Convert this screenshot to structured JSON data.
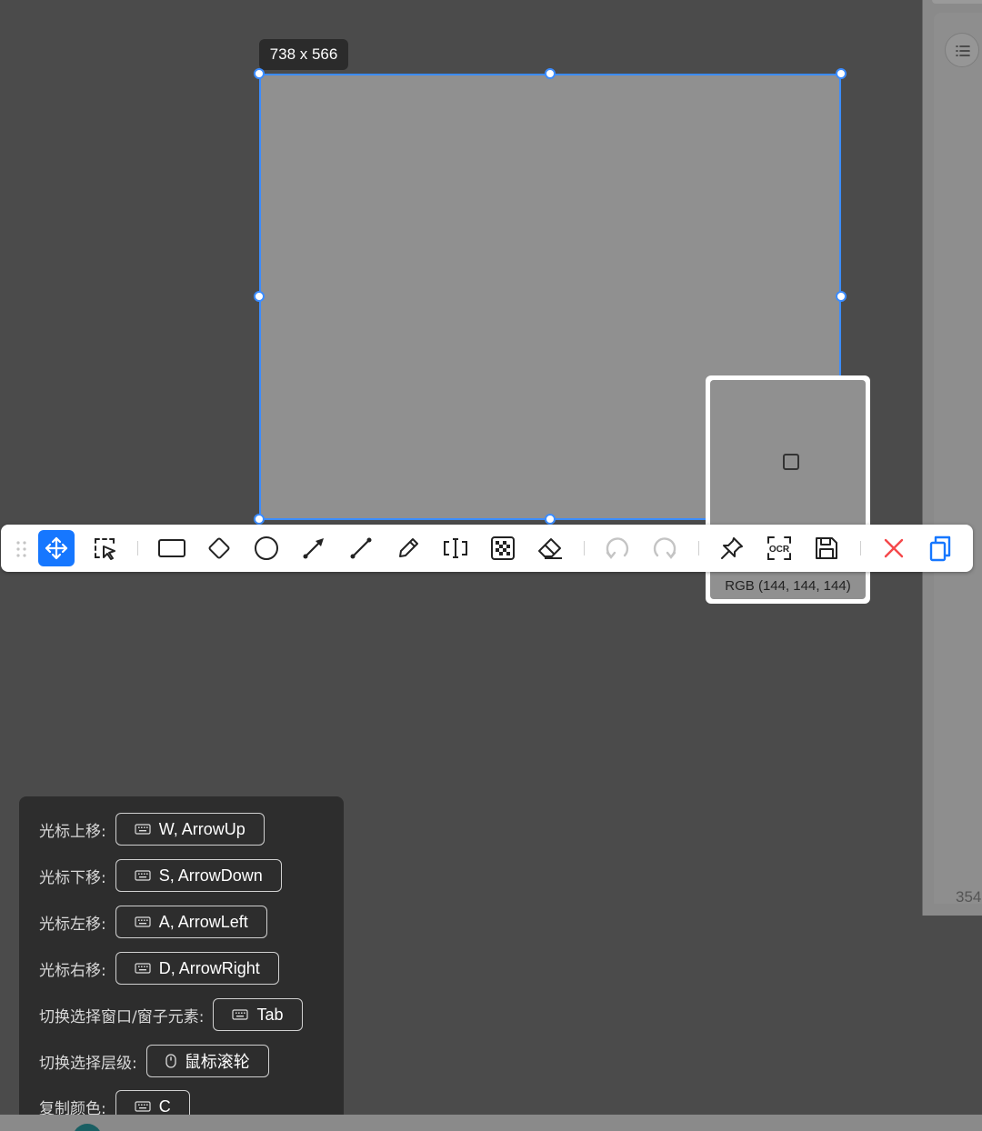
{
  "selection": {
    "size_label": "738 x 566"
  },
  "magnifier": {
    "color_text": "RGB (144, 144, 144)"
  },
  "side_window": {
    "page_number": "354"
  },
  "toolbar": {
    "tools": [
      {
        "name": "move-tool",
        "icon": "move-icon",
        "active": true
      },
      {
        "name": "select-element-tool",
        "icon": "select-element-icon"
      },
      {
        "name": "rectangle-tool",
        "icon": "rectangle-icon"
      },
      {
        "name": "diamond-tool",
        "icon": "diamond-icon"
      },
      {
        "name": "ellipse-tool",
        "icon": "circle-icon"
      },
      {
        "name": "arrow-tool",
        "icon": "arrow-icon"
      },
      {
        "name": "line-tool",
        "icon": "line-icon"
      },
      {
        "name": "pen-tool",
        "icon": "pencil-icon"
      },
      {
        "name": "text-tool",
        "icon": "text-icon"
      },
      {
        "name": "mosaic-tool",
        "icon": "mosaic-icon"
      },
      {
        "name": "eraser-tool",
        "icon": "eraser-icon"
      },
      {
        "name": "undo",
        "icon": "undo-icon",
        "disabled": true
      },
      {
        "name": "redo",
        "icon": "redo-icon",
        "disabled": true
      },
      {
        "name": "pin",
        "icon": "pin-icon"
      },
      {
        "name": "ocr",
        "icon": "ocr-icon"
      },
      {
        "name": "save",
        "icon": "save-icon"
      },
      {
        "name": "cancel",
        "icon": "close-icon",
        "color": "#f5484a"
      },
      {
        "name": "copy",
        "icon": "copy-icon",
        "color": "#1677ff"
      }
    ]
  },
  "shortcuts": [
    {
      "label": "光标上移:",
      "key": "W, ArrowUp",
      "icon": "keyboard-icon"
    },
    {
      "label": "光标下移:",
      "key": "S, ArrowDown",
      "icon": "keyboard-icon"
    },
    {
      "label": "光标左移:",
      "key": "A, ArrowLeft",
      "icon": "keyboard-icon"
    },
    {
      "label": "光标右移:",
      "key": "D, ArrowRight",
      "icon": "keyboard-icon"
    },
    {
      "label": "切换选择窗口/窗子元素:",
      "key": "Tab",
      "icon": "keyboard-icon"
    },
    {
      "label": "切换选择层级:",
      "key": "鼠标滚轮",
      "icon": "mouse-icon"
    },
    {
      "label": "复制颜色:",
      "key": "C",
      "icon": "keyboard-icon"
    }
  ],
  "colors": {
    "accent": "#1677ff",
    "selection_border": "#3b8cff",
    "danger": "#f5484a",
    "background": "#4b4b4b",
    "selection_fill": "#909090"
  }
}
